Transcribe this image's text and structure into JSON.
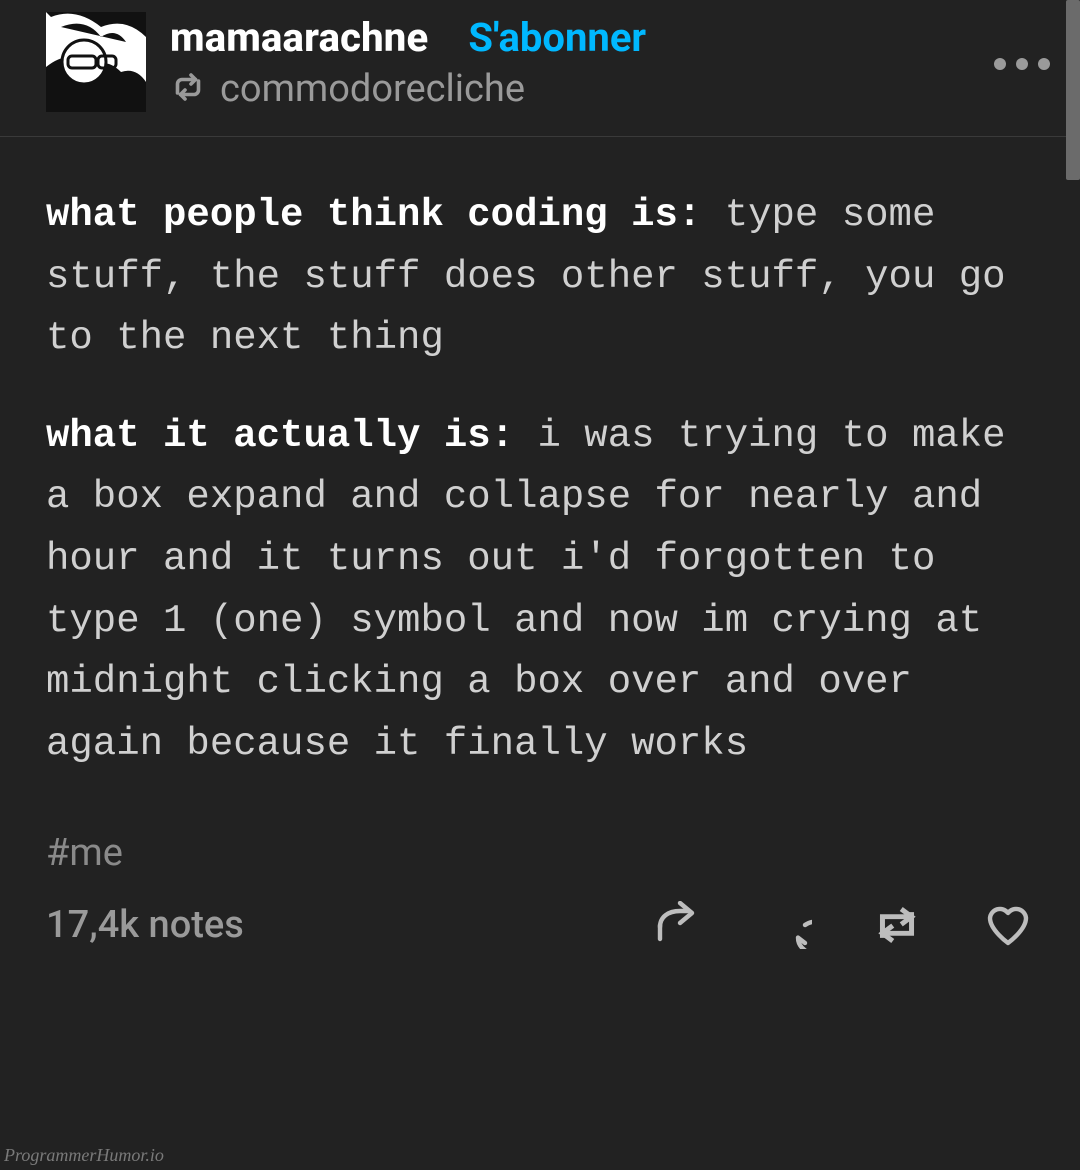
{
  "header": {
    "username": "mamaarachne",
    "follow_label": "S'abonner",
    "reblog_source": "commodorecliche"
  },
  "post": {
    "p1_bold": "what people think coding is:",
    "p1_rest": " type some stuff, the stuff does other stuff, you go to the next thing",
    "p2_bold": "what it actually is:",
    "p2_rest": " i was trying to make a box expand and collapse for nearly and hour and it turns out i'd forgotten to type 1 (one) symbol and now im crying at midnight clicking a box over and over again because it finally works"
  },
  "tags": "#me",
  "footer": {
    "notes": "17,4k notes"
  },
  "watermark": "ProgrammerHumor.io",
  "icons": {
    "reblog_source": "reblog-icon",
    "more": "more-icon",
    "share": "share-icon",
    "reply": "reply-icon",
    "reblog": "reblog-icon",
    "like": "like-icon"
  }
}
